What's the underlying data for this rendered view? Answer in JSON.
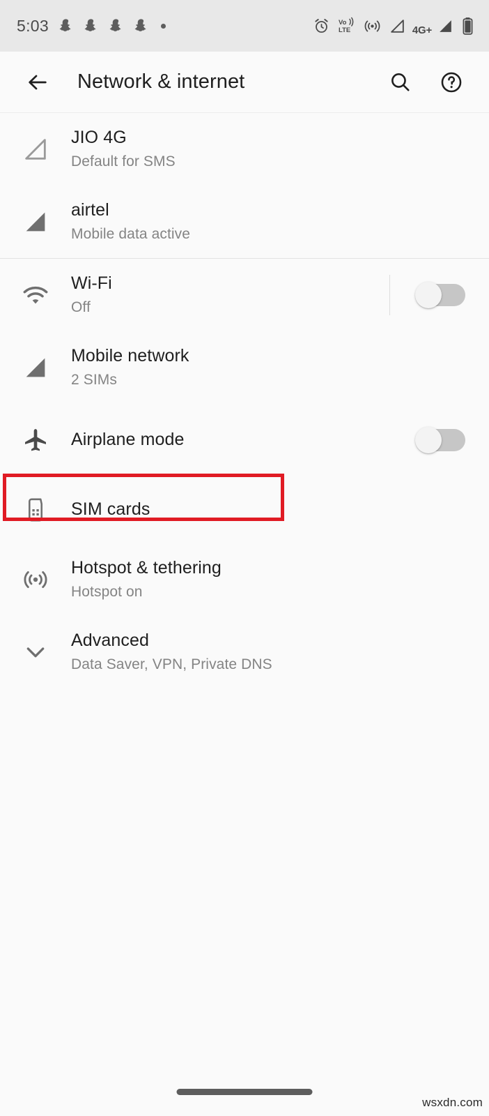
{
  "status_bar": {
    "time": "5:03",
    "left_icons": [
      "snapchat-ghost-icon",
      "snapchat-ghost-icon",
      "snapchat-ghost-icon",
      "snapchat-ghost-icon",
      "notification-dot"
    ],
    "right_icons": [
      "alarm-icon",
      "volte-icon",
      "hotspot-icon",
      "signal-sim1-icon",
      "4g-plus-label",
      "signal-sim2-icon",
      "battery-icon"
    ],
    "volte_line1": "Vo",
    "volte_line2": "LTE",
    "network_label": "4G+"
  },
  "app_bar": {
    "title": "Network & internet",
    "back_icon": "arrow-back-icon",
    "search_icon": "search-icon",
    "help_icon": "help-circle-icon"
  },
  "sim_section": [
    {
      "icon": "signal-outline-icon",
      "title": "JIO 4G",
      "subtitle": "Default for SMS"
    },
    {
      "icon": "signal-filled-icon",
      "title": "airtel",
      "subtitle": "Mobile data active"
    }
  ],
  "settings_list": [
    {
      "icon": "wifi-icon",
      "title": "Wi-Fi",
      "subtitle": "Off",
      "toggle": "off",
      "has_divider": true
    },
    {
      "icon": "signal-filled-icon",
      "title": "Mobile network",
      "subtitle": "2 SIMs",
      "toggle": null,
      "has_divider": false
    },
    {
      "icon": "airplane-icon",
      "title": "Airplane mode",
      "subtitle": "",
      "toggle": "off",
      "has_divider": false
    },
    {
      "icon": "sim-card-icon",
      "title": "SIM cards",
      "subtitle": "",
      "toggle": null,
      "has_divider": false,
      "highlighted": true
    },
    {
      "icon": "hotspot-icon",
      "title": "Hotspot & tethering",
      "subtitle": "Hotspot on",
      "toggle": null,
      "has_divider": false
    },
    {
      "icon": "chevron-down-icon",
      "title": "Advanced",
      "subtitle": "Data Saver, VPN, Private DNS",
      "toggle": null,
      "has_divider": false
    }
  ],
  "highlight": {
    "color": "#e01b24",
    "target": "SIM cards"
  },
  "nav_bar": {
    "gesture_pill": "home-gesture-pill"
  },
  "watermark": {
    "text": "wsxdn.com"
  }
}
